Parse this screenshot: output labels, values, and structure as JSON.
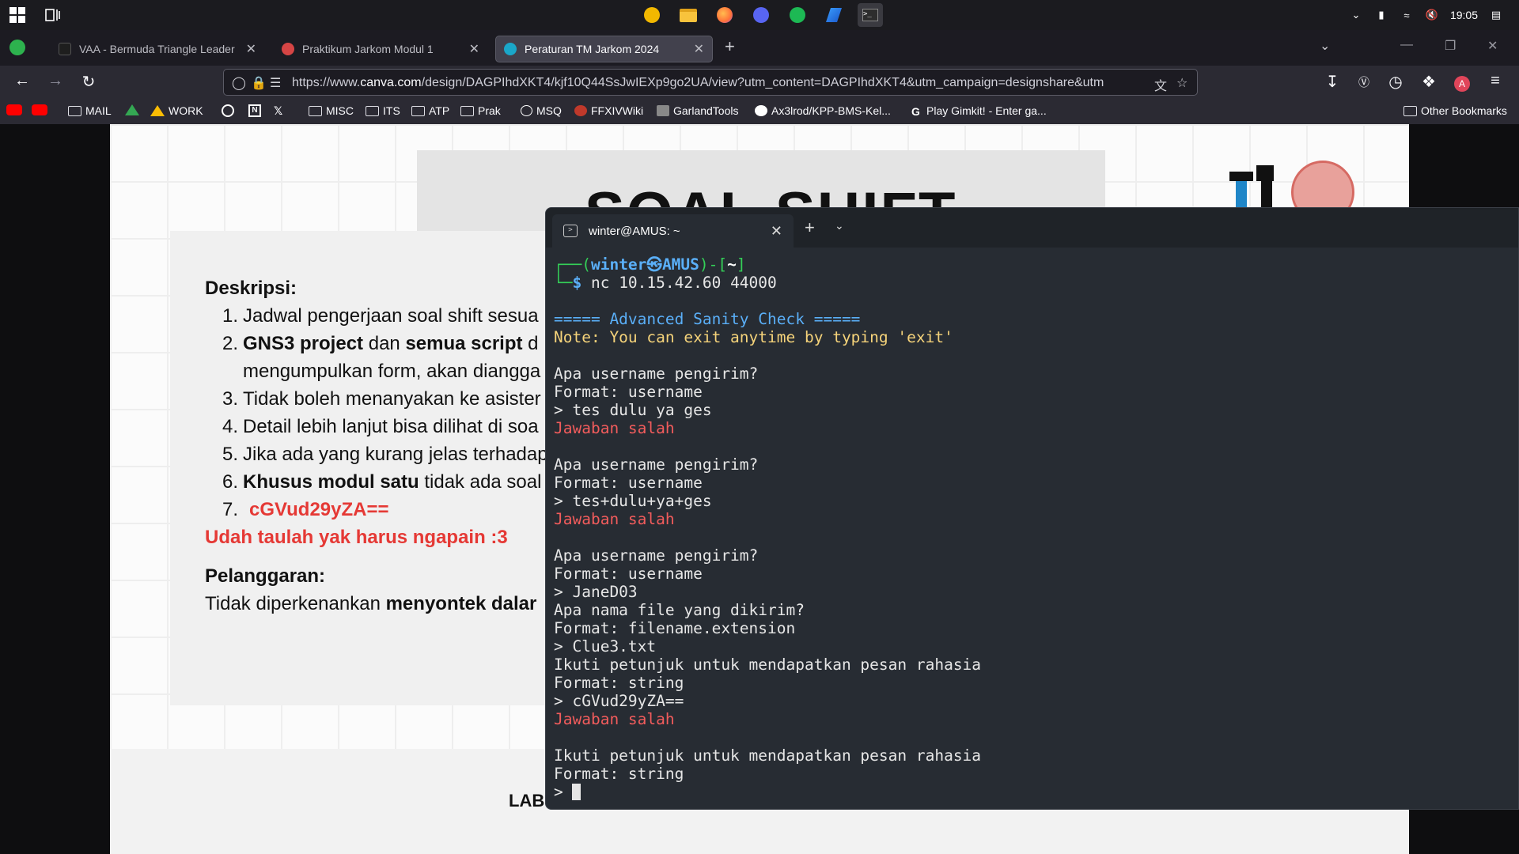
{
  "taskbar": {
    "time": "19:05",
    "apps": [
      {
        "name": "bitwarden-like-app",
        "color": "#f2b800"
      },
      {
        "name": "file-explorer",
        "color": "#f8c33c"
      },
      {
        "name": "firefox",
        "color": "#ff7139"
      },
      {
        "name": "discord",
        "color": "#5865f2"
      },
      {
        "name": "spotify",
        "color": "#1db954"
      },
      {
        "name": "app-blue",
        "color": "#2b7de9"
      },
      {
        "name": "terminal",
        "color": "#444"
      }
    ]
  },
  "browser": {
    "tabs": [
      {
        "title": "VAA - Bermuda Triangle Leader",
        "fav_color": "#1e1e1e"
      },
      {
        "title": "Praktikum Jarkom Modul 1",
        "fav_color": "#d64545"
      },
      {
        "title": "Peraturan TM Jarkom 2024",
        "fav_color": "#1aa7c9"
      }
    ],
    "url_prefix": "https://www.",
    "url_host": "canva.com",
    "url_path": "/design/DAGPIhdXKT4/kjf10Q44SsJwIEXp9go2UA/view?utm_content=DAGPIhdXKT4&utm_campaign=designshare&utm",
    "bookmarks": [
      {
        "label": "MAIL",
        "type": "folder"
      },
      {
        "label": "WORK",
        "type": "drive"
      },
      {
        "label": "MISC",
        "type": "folder"
      },
      {
        "label": "ITS",
        "type": "folder"
      },
      {
        "label": "ATP",
        "type": "folder"
      },
      {
        "label": "Prak",
        "type": "folder"
      },
      {
        "label": "MSQ",
        "type": "globe"
      },
      {
        "label": "FFXIVWiki",
        "type": "site"
      },
      {
        "label": "GarlandTools",
        "type": "site"
      },
      {
        "label": "Ax3lrod/KPP-BMS-Kel...",
        "type": "github"
      },
      {
        "label": "Play Gimkit! - Enter ga...",
        "type": "google"
      },
      {
        "label": "Other Bookmarks",
        "type": "folder"
      }
    ]
  },
  "slide": {
    "title": "SOAL SHIFT",
    "desc_heading": "Deskripsi:",
    "items": [
      {
        "num": "1.",
        "text": "Jadwal pengerjaan soal shift sesua"
      },
      {
        "num": "2.",
        "bold1": "GNS3 project",
        "mid": " dan ",
        "bold2": "semua script",
        "rest": " d"
      },
      {
        "num": "",
        "text": "mengumpulkan form, akan diangga"
      },
      {
        "num": "3.",
        "text": "Tidak boleh menanyakan ke asister"
      },
      {
        "num": "4.",
        "text": "Detail lebih lanjut bisa dilihat di soa"
      },
      {
        "num": "5.",
        "text": "Jika ada yang kurang jelas terhadap"
      },
      {
        "num": "6.",
        "bold": "Khusus modul satu",
        "text": " tidak ada soal"
      },
      {
        "num": "7.",
        "text": "cGVud29yZA=="
      }
    ],
    "red_line": "Udah taulah yak harus ngapain :3",
    "viol_heading": "Pelanggaran:",
    "viol_text_pre": "Tidak diperkenankan ",
    "viol_text_bold": "menyontek dalar",
    "footer": "LAB"
  },
  "terminal": {
    "tab_title": "winter@AMUS: ~",
    "prompt_user": "winter",
    "prompt_host": "AMUS",
    "prompt_dir": "~",
    "command": "nc 10.15.42.60 44000",
    "header": "===== Advanced Sanity Check =====",
    "note": "Note: You can exit anytime by typing 'exit'",
    "q_user": "Apa username pengirim?",
    "fmt_user": "Format: username",
    "ans1": "> tes dulu ya ges",
    "wrong": "Jawaban salah",
    "ans2": "> tes+dulu+ya+ges",
    "ans3": "> JaneD03",
    "q_file": "Apa nama file yang dikirim?",
    "fmt_file": "Format: filename.extension",
    "ans_file": "> Clue3.txt",
    "q_secret": "Ikuti petunjuk untuk mendapatkan pesan rahasia",
    "fmt_secret": "Format: string",
    "ans_secret": "> cGVud29yZA==",
    "final_prompt": "> "
  }
}
